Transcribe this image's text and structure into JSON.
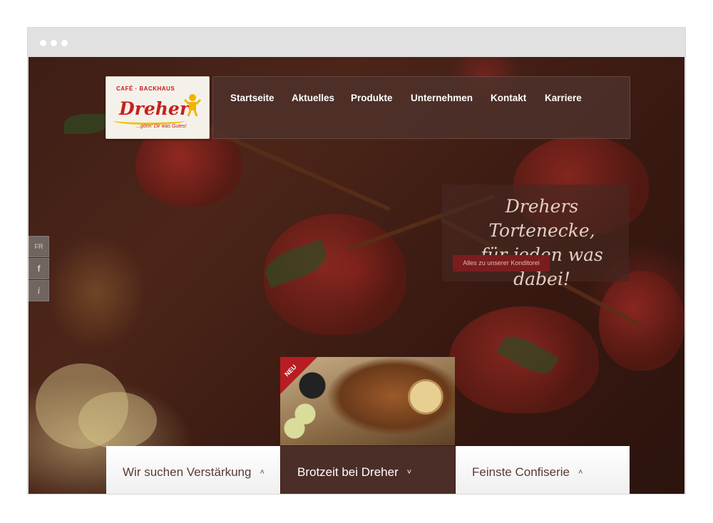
{
  "logo": {
    "top_line": "CAFÉ · BACKHAUS",
    "name": "Dreher",
    "tagline": "...gönn' Dir was Gutes!"
  },
  "nav": {
    "items": [
      {
        "label": "Startseite"
      },
      {
        "label": "Aktuelles"
      },
      {
        "label": "Produkte"
      },
      {
        "label": "Unternehmen"
      },
      {
        "label": "Kontakt"
      },
      {
        "label": "Karriere"
      }
    ]
  },
  "hero": {
    "headline_line1": "Drehers Tortenecke,",
    "headline_line2": "für jeden was dabei!",
    "button_label": "Alles zu unserer Konditorei"
  },
  "side": {
    "lang": "FR",
    "facebook": "f",
    "info": "i"
  },
  "badge": {
    "new_label": "NEU"
  },
  "cards": [
    {
      "title": "Wir suchen Verstärkung",
      "chevron": "˄"
    },
    {
      "title": "Brotzeit bei Dreher",
      "chevron": "˅"
    },
    {
      "title": "Feinste Confiserie",
      "chevron": "˄"
    }
  ],
  "colors": {
    "accent_red": "#b71d22",
    "nav_bg": "#4e322c",
    "dark_card": "#4c2e28"
  }
}
